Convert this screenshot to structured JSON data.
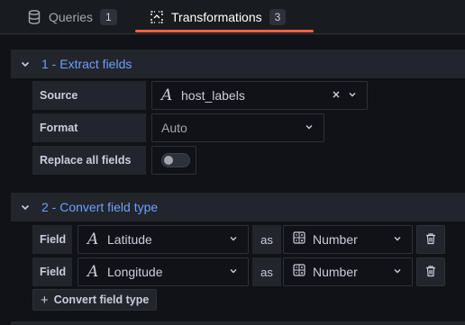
{
  "tabs": [
    {
      "label": "Queries",
      "count": "1",
      "icon": "database-icon"
    },
    {
      "label": "Transformations",
      "count": "3",
      "icon": "transform-icon",
      "active": true
    }
  ],
  "colors": {
    "accent": "#f55f3e",
    "link": "#6e9fff",
    "bg": "#111217",
    "surface": "#22252b"
  },
  "section1": {
    "title": "1 - Extract fields",
    "source_label": "Source",
    "source_value": "host_labels",
    "format_label": "Format",
    "format_value": "Auto",
    "replace_label": "Replace all fields",
    "replace_on": false
  },
  "section2": {
    "title": "2 - Convert field type",
    "rows": [
      {
        "label": "Field",
        "field": "Latitude",
        "as": "as",
        "type": "Number"
      },
      {
        "label": "Field",
        "field": "Longitude",
        "as": "as",
        "type": "Number"
      }
    ],
    "add_label": "Convert field type"
  }
}
